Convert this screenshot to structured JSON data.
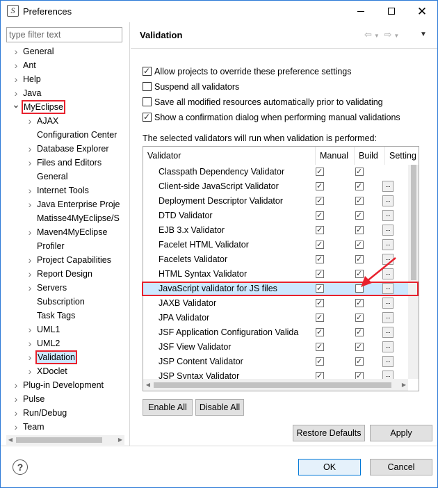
{
  "window": {
    "title": "Preferences",
    "app_icon_glyph": "S"
  },
  "left": {
    "filter_placeholder": "type filter text",
    "tree": [
      {
        "label": "General",
        "level": 0,
        "arrow": "collapsed"
      },
      {
        "label": "Ant",
        "level": 0,
        "arrow": "collapsed"
      },
      {
        "label": "Help",
        "level": 0,
        "arrow": "collapsed"
      },
      {
        "label": "Java",
        "level": 0,
        "arrow": "collapsed"
      },
      {
        "label": "MyEclipse",
        "level": 0,
        "arrow": "expanded",
        "highlighted": true
      },
      {
        "label": "AJAX",
        "level": 1,
        "arrow": "collapsed"
      },
      {
        "label": "Configuration Center",
        "level": 1,
        "arrow": "none"
      },
      {
        "label": "Database Explorer",
        "level": 1,
        "arrow": "collapsed"
      },
      {
        "label": "Files and Editors",
        "level": 1,
        "arrow": "collapsed"
      },
      {
        "label": "General",
        "level": 1,
        "arrow": "none"
      },
      {
        "label": "Internet Tools",
        "level": 1,
        "arrow": "collapsed"
      },
      {
        "label": "Java Enterprise Proje",
        "level": 1,
        "arrow": "collapsed"
      },
      {
        "label": "Matisse4MyEclipse/S",
        "level": 1,
        "arrow": "none"
      },
      {
        "label": "Maven4MyEclipse",
        "level": 1,
        "arrow": "collapsed"
      },
      {
        "label": "Profiler",
        "level": 1,
        "arrow": "none"
      },
      {
        "label": "Project Capabilities",
        "level": 1,
        "arrow": "collapsed"
      },
      {
        "label": "Report Design",
        "level": 1,
        "arrow": "collapsed"
      },
      {
        "label": "Servers",
        "level": 1,
        "arrow": "collapsed"
      },
      {
        "label": "Subscription",
        "level": 1,
        "arrow": "none"
      },
      {
        "label": "Task Tags",
        "level": 1,
        "arrow": "none"
      },
      {
        "label": "UML1",
        "level": 1,
        "arrow": "collapsed"
      },
      {
        "label": "UML2",
        "level": 1,
        "arrow": "collapsed"
      },
      {
        "label": "Validation",
        "level": 1,
        "arrow": "collapsed",
        "highlighted": true,
        "selected": true
      },
      {
        "label": "XDoclet",
        "level": 1,
        "arrow": "collapsed"
      },
      {
        "label": "Plug-in Development",
        "level": 0,
        "arrow": "collapsed"
      },
      {
        "label": "Pulse",
        "level": 0,
        "arrow": "collapsed"
      },
      {
        "label": "Run/Debug",
        "level": 0,
        "arrow": "collapsed"
      },
      {
        "label": "Team",
        "level": 0,
        "arrow": "collapsed"
      }
    ]
  },
  "right": {
    "title": "Validation",
    "options": [
      {
        "label": "Allow projects to override these preference settings",
        "checked": true
      },
      {
        "label": "Suspend all validators",
        "checked": false
      },
      {
        "label": "Save all modified resources automatically prior to validating",
        "checked": false
      },
      {
        "label": "Show a confirmation dialog when performing manual validations",
        "checked": true
      }
    ],
    "info": "The selected validators will run when validation is performed:",
    "table": {
      "headers": [
        "Validator",
        "Manual",
        "Build",
        "Setting"
      ],
      "settings_button_label": "...",
      "rows": [
        {
          "name": "Classpath Dependency Validator",
          "manual": true,
          "build": true,
          "settings": false
        },
        {
          "name": "Client-side JavaScript Validator",
          "manual": true,
          "build": true,
          "settings": true
        },
        {
          "name": "Deployment Descriptor Validator",
          "manual": true,
          "build": true,
          "settings": true
        },
        {
          "name": "DTD Validator",
          "manual": true,
          "build": true,
          "settings": true
        },
        {
          "name": "EJB 3.x Validator",
          "manual": true,
          "build": true,
          "settings": true
        },
        {
          "name": "Facelet HTML Validator",
          "manual": true,
          "build": true,
          "settings": true
        },
        {
          "name": "Facelets Validator",
          "manual": true,
          "build": true,
          "settings": true
        },
        {
          "name": "HTML Syntax Validator",
          "manual": true,
          "build": true,
          "settings": true
        },
        {
          "name": "JavaScript validator for JS files",
          "manual": true,
          "build": false,
          "settings": true,
          "selected": true
        },
        {
          "name": "JAXB Validator",
          "manual": true,
          "build": true,
          "settings": true
        },
        {
          "name": "JPA Validator",
          "manual": true,
          "build": true,
          "settings": true
        },
        {
          "name": "JSF Application Configuration Valida",
          "manual": true,
          "build": true,
          "settings": true
        },
        {
          "name": "JSF View Validator",
          "manual": true,
          "build": true,
          "settings": true
        },
        {
          "name": "JSP Content Validator",
          "manual": true,
          "build": true,
          "settings": true
        },
        {
          "name": "JSP Syntax Validator",
          "manual": true,
          "build": true,
          "settings": true
        }
      ]
    },
    "buttons": {
      "enable_all": "Enable All",
      "disable_all": "Disable All",
      "restore_defaults": "Restore Defaults",
      "apply": "Apply"
    }
  },
  "footer": {
    "ok": "OK",
    "cancel": "Cancel",
    "help_glyph": "?"
  },
  "colors": {
    "highlight_box": "#e8212d",
    "selection": "#cce8ff",
    "window_border": "#2b79d6"
  }
}
